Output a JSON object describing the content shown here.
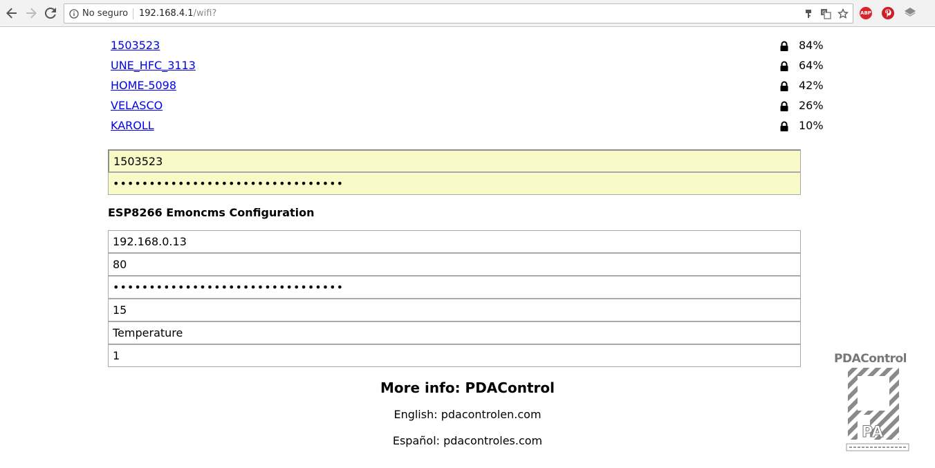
{
  "browser": {
    "security_label": "No seguro",
    "url_host": "192.168.4.1",
    "url_path": "/wifi?",
    "icons": [
      "back-arrow-icon",
      "forward-arrow-icon",
      "reload-icon",
      "info-icon",
      "key-icon",
      "translate-icon",
      "star-icon",
      "adblock-icon",
      "pinterest-icon",
      "layers-icon"
    ],
    "adblock_label": "ABP"
  },
  "networks": [
    {
      "ssid": "1503523",
      "signal": "84%"
    },
    {
      "ssid": "UNE_HFC_3113",
      "signal": "64%"
    },
    {
      "ssid": "HOME-5098",
      "signal": "42%"
    },
    {
      "ssid": "VELASCO",
      "signal": "26%"
    },
    {
      "ssid": "KAROLL",
      "signal": "10%"
    }
  ],
  "wifi_form": {
    "ssid_value": "1503523",
    "password_value": "••••••••••••••••••••••••••••••••"
  },
  "emoncms": {
    "title": "ESP8266 Emoncms Configuration",
    "server": "192.168.0.13",
    "port": "80",
    "apikey": "••••••••••••••••••••••••••••••••",
    "interval": "15",
    "sensor": "Temperature",
    "node": "1"
  },
  "footer": {
    "more_info": "More info: PDAControl",
    "english": "English: pdacontrolen.com",
    "spanish": "Español: pdacontroles.com"
  },
  "logo": {
    "brand": "PDAControl"
  },
  "colors": {
    "link": "#0000ee",
    "autofill": "#fafac8",
    "adblock": "#d9232d",
    "pinterest": "#cb2027"
  }
}
